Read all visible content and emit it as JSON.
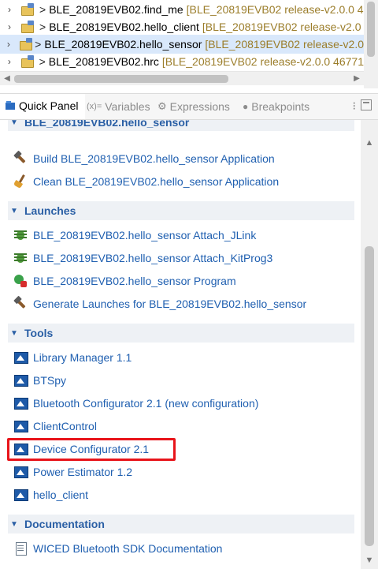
{
  "project_explorer": {
    "rows": [
      {
        "name": "BLE_20819EVB02.find_me",
        "desc": "[BLE_20819EVB02 release-v2.0.0 4",
        "selected": false
      },
      {
        "name": "BLE_20819EVB02.hello_client",
        "desc": "[BLE_20819EVB02 release-v2.0",
        "selected": false
      },
      {
        "name": "BLE_20819EVB02.hello_sensor",
        "desc": "[BLE_20819EVB02 release-v2.0",
        "selected": true
      },
      {
        "name": "BLE_20819EVB02.hrc",
        "desc": "[BLE_20819EVB02 release-v2.0.0 46771",
        "selected": false
      }
    ],
    "arrow_glyph": ">"
  },
  "tabs": {
    "quick_panel": "Quick Panel",
    "variables": "Variables",
    "variables_icon": "(x)=",
    "expressions": "Expressions",
    "breakpoints": "Breakpoints"
  },
  "quick_panel": {
    "project_header": "BLE_20819EVB02.hello_sensor",
    "project_items": [
      {
        "label": "Build BLE_20819EVB02.hello_sensor Application",
        "icon": "hammer-icon"
      },
      {
        "label": "Clean BLE_20819EVB02.hello_sensor Application",
        "icon": "broom-icon"
      }
    ],
    "launches_header": "Launches",
    "launch_items": [
      {
        "label": "BLE_20819EVB02.hello_sensor Attach_JLink",
        "icon": "bug-icon"
      },
      {
        "label": "BLE_20819EVB02.hello_sensor Attach_KitProg3",
        "icon": "bug-icon"
      },
      {
        "label": "BLE_20819EVB02.hello_sensor Program",
        "icon": "program-icon"
      },
      {
        "label": "Generate Launches for BLE_20819EVB02.hello_sensor",
        "icon": "hammer-icon"
      }
    ],
    "tools_header": "Tools",
    "tool_items": [
      {
        "label": "Library Manager 1.1"
      },
      {
        "label": "BTSpy"
      },
      {
        "label": "Bluetooth Configurator 2.1 (new configuration)"
      },
      {
        "label": "ClientControl"
      },
      {
        "label": "Device Configurator 2.1",
        "highlighted": true
      },
      {
        "label": "Power Estimator 1.2"
      },
      {
        "label": "hello_client"
      }
    ],
    "documentation_header": "Documentation",
    "doc_items": [
      {
        "label": "WICED Bluetooth SDK Documentation"
      }
    ]
  },
  "colors": {
    "link": "#1f5fb0",
    "highlight": "#e8141a",
    "selection": "#d9e8fb",
    "project_desc": "#9b7d2a"
  }
}
